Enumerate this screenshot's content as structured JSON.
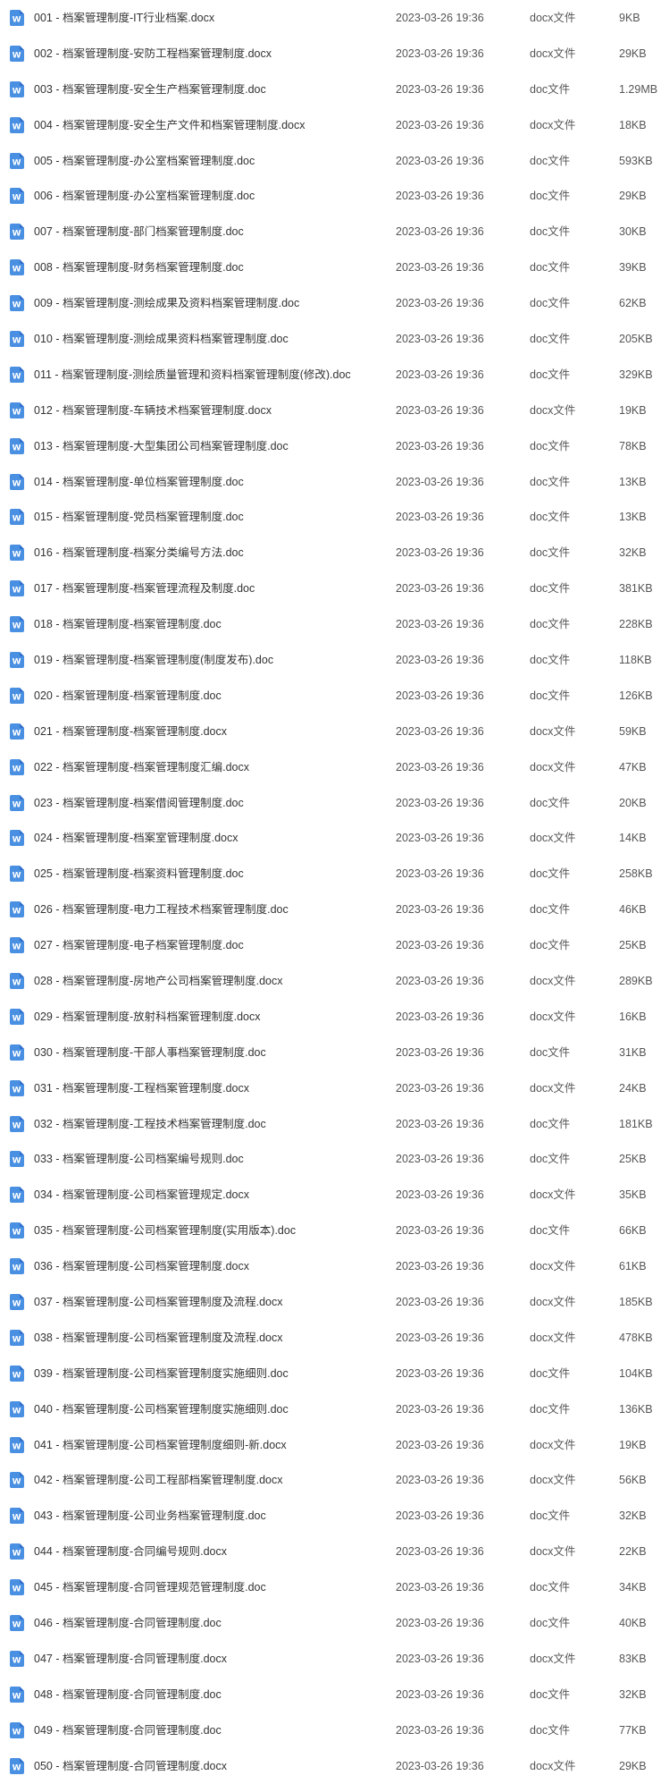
{
  "colors": {
    "icon_blue": "#4A90E2",
    "icon_blue_dark": "#2F6FCC",
    "text": "#333333",
    "meta_text": "#555555"
  },
  "icon_name": "word-document-icon",
  "icon_glyph": "W",
  "files": [
    {
      "name": "001 - 档案管理制度-IT行业档案.docx",
      "modified": "2023-03-26 19:36",
      "type": "docx文件",
      "size": "9KB"
    },
    {
      "name": "002 - 档案管理制度-安防工程档案管理制度.docx",
      "modified": "2023-03-26 19:36",
      "type": "docx文件",
      "size": "29KB"
    },
    {
      "name": "003 - 档案管理制度-安全生产档案管理制度.doc",
      "modified": "2023-03-26 19:36",
      "type": "doc文件",
      "size": "1.29MB"
    },
    {
      "name": "004 - 档案管理制度-安全生产文件和档案管理制度.docx",
      "modified": "2023-03-26 19:36",
      "type": "docx文件",
      "size": "18KB"
    },
    {
      "name": "005 - 档案管理制度-办公室档案管理制度.doc",
      "modified": "2023-03-26 19:36",
      "type": "doc文件",
      "size": "593KB"
    },
    {
      "name": "006 - 档案管理制度-办公室档案管理制度.doc",
      "modified": "2023-03-26 19:36",
      "type": "doc文件",
      "size": "29KB"
    },
    {
      "name": "007 - 档案管理制度-部门档案管理制度.doc",
      "modified": "2023-03-26 19:36",
      "type": "doc文件",
      "size": "30KB"
    },
    {
      "name": "008 - 档案管理制度-财务档案管理制度.doc",
      "modified": "2023-03-26 19:36",
      "type": "doc文件",
      "size": "39KB"
    },
    {
      "name": "009 - 档案管理制度-测绘成果及资料档案管理制度.doc",
      "modified": "2023-03-26 19:36",
      "type": "doc文件",
      "size": "62KB"
    },
    {
      "name": "010 - 档案管理制度-测绘成果资料档案管理制度.doc",
      "modified": "2023-03-26 19:36",
      "type": "doc文件",
      "size": "205KB"
    },
    {
      "name": "011 - 档案管理制度-测绘质量管理和资料档案管理制度(修改).doc",
      "modified": "2023-03-26 19:36",
      "type": "doc文件",
      "size": "329KB"
    },
    {
      "name": "012 - 档案管理制度-车辆技术档案管理制度.docx",
      "modified": "2023-03-26 19:36",
      "type": "docx文件",
      "size": "19KB"
    },
    {
      "name": "013 - 档案管理制度-大型集团公司档案管理制度.doc",
      "modified": "2023-03-26 19:36",
      "type": "doc文件",
      "size": "78KB"
    },
    {
      "name": "014 - 档案管理制度-单位档案管理制度.doc",
      "modified": "2023-03-26 19:36",
      "type": "doc文件",
      "size": "13KB"
    },
    {
      "name": "015 - 档案管理制度-党员档案管理制度.doc",
      "modified": "2023-03-26 19:36",
      "type": "doc文件",
      "size": "13KB"
    },
    {
      "name": "016 - 档案管理制度-档案分类编号方法.doc",
      "modified": "2023-03-26 19:36",
      "type": "doc文件",
      "size": "32KB"
    },
    {
      "name": "017 - 档案管理制度-档案管理流程及制度.doc",
      "modified": "2023-03-26 19:36",
      "type": "doc文件",
      "size": "381KB"
    },
    {
      "name": "018 - 档案管理制度-档案管理制度.doc",
      "modified": "2023-03-26 19:36",
      "type": "doc文件",
      "size": "228KB"
    },
    {
      "name": "019 - 档案管理制度-档案管理制度(制度发布).doc",
      "modified": "2023-03-26 19:36",
      "type": "doc文件",
      "size": "118KB"
    },
    {
      "name": "020 - 档案管理制度-档案管理制度.doc",
      "modified": "2023-03-26 19:36",
      "type": "doc文件",
      "size": "126KB"
    },
    {
      "name": "021 - 档案管理制度-档案管理制度.docx",
      "modified": "2023-03-26 19:36",
      "type": "docx文件",
      "size": "59KB"
    },
    {
      "name": "022 - 档案管理制度-档案管理制度汇编.docx",
      "modified": "2023-03-26 19:36",
      "type": "docx文件",
      "size": "47KB"
    },
    {
      "name": "023 - 档案管理制度-档案借阅管理制度.doc",
      "modified": "2023-03-26 19:36",
      "type": "doc文件",
      "size": "20KB"
    },
    {
      "name": "024 - 档案管理制度-档案室管理制度.docx",
      "modified": "2023-03-26 19:36",
      "type": "docx文件",
      "size": "14KB"
    },
    {
      "name": "025 - 档案管理制度-档案资料管理制度.doc",
      "modified": "2023-03-26 19:36",
      "type": "doc文件",
      "size": "258KB"
    },
    {
      "name": "026 - 档案管理制度-电力工程技术档案管理制度.doc",
      "modified": "2023-03-26 19:36",
      "type": "doc文件",
      "size": "46KB"
    },
    {
      "name": "027 - 档案管理制度-电子档案管理制度.doc",
      "modified": "2023-03-26 19:36",
      "type": "doc文件",
      "size": "25KB"
    },
    {
      "name": "028 - 档案管理制度-房地产公司档案管理制度.docx",
      "modified": "2023-03-26 19:36",
      "type": "docx文件",
      "size": "289KB"
    },
    {
      "name": "029 - 档案管理制度-放射科档案管理制度.docx",
      "modified": "2023-03-26 19:36",
      "type": "docx文件",
      "size": "16KB"
    },
    {
      "name": "030 - 档案管理制度-干部人事档案管理制度.doc",
      "modified": "2023-03-26 19:36",
      "type": "doc文件",
      "size": "31KB"
    },
    {
      "name": "031 - 档案管理制度-工程档案管理制度.docx",
      "modified": "2023-03-26 19:36",
      "type": "docx文件",
      "size": "24KB"
    },
    {
      "name": "032 - 档案管理制度-工程技术档案管理制度.doc",
      "modified": "2023-03-26 19:36",
      "type": "doc文件",
      "size": "181KB"
    },
    {
      "name": "033 - 档案管理制度-公司档案编号规则.doc",
      "modified": "2023-03-26 19:36",
      "type": "doc文件",
      "size": "25KB"
    },
    {
      "name": "034 - 档案管理制度-公司档案管理规定.docx",
      "modified": "2023-03-26 19:36",
      "type": "docx文件",
      "size": "35KB"
    },
    {
      "name": "035 - 档案管理制度-公司档案管理制度(实用版本).doc",
      "modified": "2023-03-26 19:36",
      "type": "doc文件",
      "size": "66KB"
    },
    {
      "name": "036 - 档案管理制度-公司档案管理制度.docx",
      "modified": "2023-03-26 19:36",
      "type": "docx文件",
      "size": "61KB"
    },
    {
      "name": "037 - 档案管理制度-公司档案管理制度及流程.docx",
      "modified": "2023-03-26 19:36",
      "type": "docx文件",
      "size": "185KB"
    },
    {
      "name": "038 - 档案管理制度-公司档案管理制度及流程.docx",
      "modified": "2023-03-26 19:36",
      "type": "docx文件",
      "size": "478KB"
    },
    {
      "name": "039 - 档案管理制度-公司档案管理制度实施细则.doc",
      "modified": "2023-03-26 19:36",
      "type": "doc文件",
      "size": "104KB"
    },
    {
      "name": "040 - 档案管理制度-公司档案管理制度实施细则.doc",
      "modified": "2023-03-26 19:36",
      "type": "doc文件",
      "size": "136KB"
    },
    {
      "name": "041 - 档案管理制度-公司档案管理制度细则-新.docx",
      "modified": "2023-03-26 19:36",
      "type": "docx文件",
      "size": "19KB"
    },
    {
      "name": "042 - 档案管理制度-公司工程部档案管理制度.docx",
      "modified": "2023-03-26 19:36",
      "type": "docx文件",
      "size": "56KB"
    },
    {
      "name": "043 - 档案管理制度-公司业务档案管理制度.doc",
      "modified": "2023-03-26 19:36",
      "type": "doc文件",
      "size": "32KB"
    },
    {
      "name": "044 - 档案管理制度-合同编号规则.docx",
      "modified": "2023-03-26 19:36",
      "type": "docx文件",
      "size": "22KB"
    },
    {
      "name": "045 - 档案管理制度-合同管理规范管理制度.doc",
      "modified": "2023-03-26 19:36",
      "type": "doc文件",
      "size": "34KB"
    },
    {
      "name": "046 - 档案管理制度-合同管理制度.doc",
      "modified": "2023-03-26 19:36",
      "type": "doc文件",
      "size": "40KB"
    },
    {
      "name": "047 - 档案管理制度-合同管理制度.docx",
      "modified": "2023-03-26 19:36",
      "type": "docx文件",
      "size": "83KB"
    },
    {
      "name": "048 - 档案管理制度-合同管理制度.doc",
      "modified": "2023-03-26 19:36",
      "type": "doc文件",
      "size": "32KB"
    },
    {
      "name": "049 - 档案管理制度-合同管理制度.doc",
      "modified": "2023-03-26 19:36",
      "type": "doc文件",
      "size": "77KB"
    },
    {
      "name": "050 - 档案管理制度-合同管理制度.docx",
      "modified": "2023-03-26 19:36",
      "type": "docx文件",
      "size": "29KB"
    }
  ]
}
